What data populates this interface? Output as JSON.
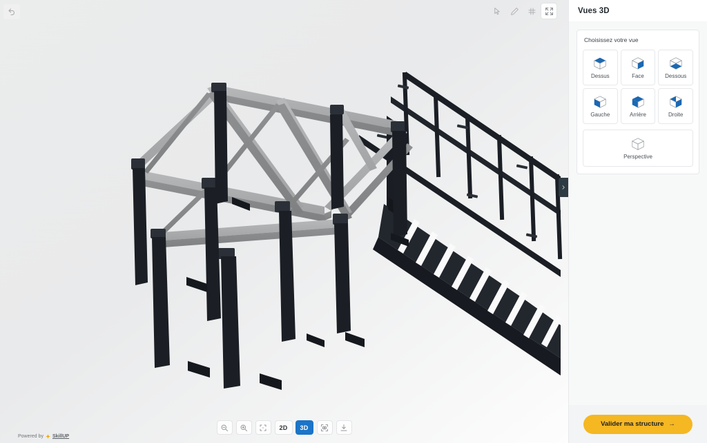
{
  "viewport": {
    "undo_icon": "undo-arrow-icon",
    "top_tools": [
      {
        "icon": "cursor-select-icon",
        "name": "select-tool",
        "active": false
      },
      {
        "icon": "pencil-edit-icon",
        "name": "edit-tool",
        "active": false
      },
      {
        "icon": "grid-icon",
        "name": "grid-tool",
        "active": false
      },
      {
        "icon": "fullscreen-expand-icon",
        "name": "fullscreen-tool",
        "active": true
      }
    ],
    "bottom_toolbar": [
      {
        "icon": "zoom-out-icon",
        "name": "zoom-out-button",
        "label": ""
      },
      {
        "icon": "zoom-in-icon",
        "name": "zoom-in-button",
        "label": ""
      },
      {
        "icon": "fit-to-screen-icon",
        "name": "fit-screen-button",
        "label": ""
      },
      {
        "icon": "screenshot-icon",
        "name": "screenshot-button",
        "label": ""
      },
      {
        "icon": "download-icon",
        "name": "download-button",
        "label": ""
      }
    ],
    "dimension_toggle": {
      "options": [
        "2D",
        "3D"
      ],
      "selected": "3D",
      "active_color": "#1b74c8"
    },
    "powered_by": {
      "prefix": "Powered by",
      "brand": "SkillUP"
    },
    "collapse_tab_icon": "chevron-right-icon",
    "model": {
      "description": "3D steel structure with pergola frame and staircase",
      "beam_color": "#9b9d9f",
      "post_color": "#1c2026",
      "background": "#ecedee"
    }
  },
  "panel": {
    "title": "Vues 3D",
    "card_label": "Choisissez votre vue",
    "views": [
      {
        "label": "Dessus",
        "name": "view-button-top",
        "face": "top"
      },
      {
        "label": "Face",
        "name": "view-button-front",
        "face": "front"
      },
      {
        "label": "Dessous",
        "name": "view-button-bottom",
        "face": "bottom"
      },
      {
        "label": "Gauche",
        "name": "view-button-left",
        "face": "left"
      },
      {
        "label": "Arrière",
        "name": "view-button-back",
        "face": "back"
      },
      {
        "label": "Droite",
        "name": "view-button-right",
        "face": "right"
      }
    ],
    "perspective": {
      "label": "Perspective",
      "name": "view-button-perspective",
      "face": "none"
    },
    "accent_color": "#1b68b3",
    "footer": {
      "validate_label": "Valider ma structure",
      "validate_arrow": "→",
      "validate_color": "#f5b722"
    }
  }
}
